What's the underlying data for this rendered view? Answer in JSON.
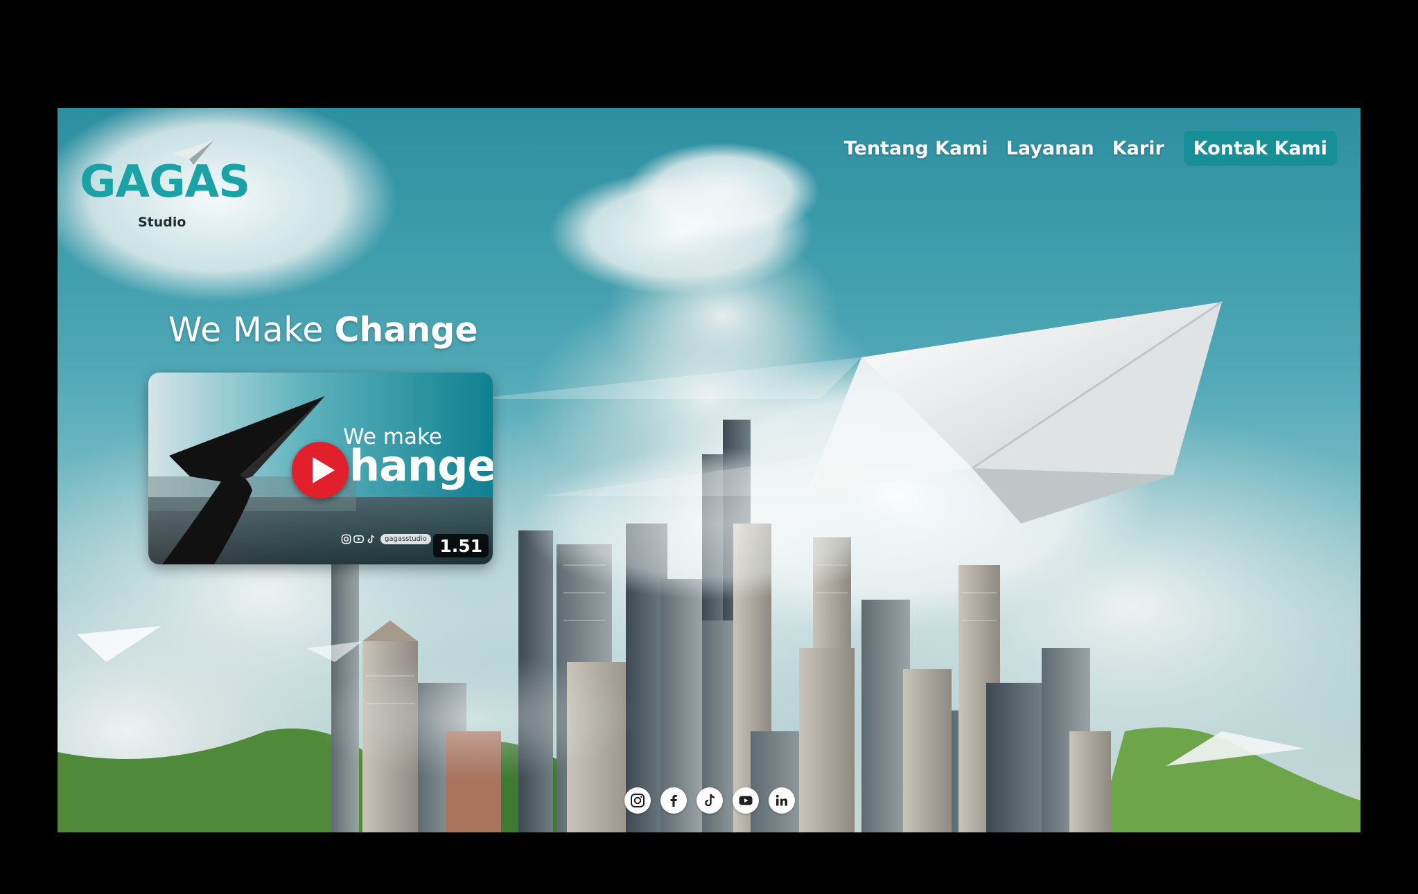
{
  "brand": {
    "name": "GAGAS",
    "subtitle": "Studio",
    "color": "#1aa3a7"
  },
  "nav": {
    "items": [
      {
        "label": "Tentang Kami"
      },
      {
        "label": "Layanan"
      },
      {
        "label": "Karir"
      }
    ],
    "cta_label": "Kontak Kami",
    "cta_color": "#168f97"
  },
  "hero": {
    "headline_light": "We Make",
    "headline_bold": "Change"
  },
  "video": {
    "title_small": "We make",
    "title_big": "hange",
    "handle": "gagasstudio",
    "duration": "1.51",
    "play_color": "#e1202b"
  },
  "social": [
    {
      "icon": "instagram-icon"
    },
    {
      "icon": "facebook-icon"
    },
    {
      "icon": "tiktok-icon"
    },
    {
      "icon": "youtube-icon"
    },
    {
      "icon": "linkedin-icon"
    }
  ]
}
